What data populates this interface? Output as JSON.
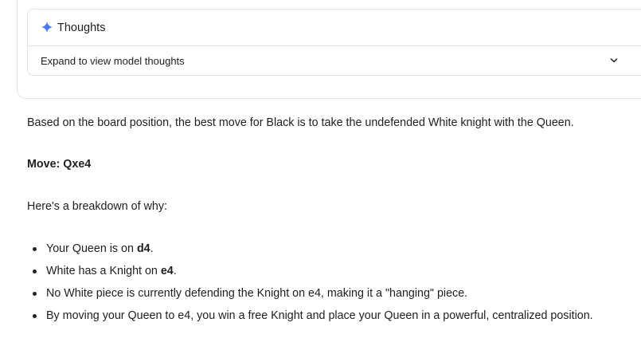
{
  "thoughts": {
    "title": "Thoughts",
    "expand_label": "Expand to view model thoughts",
    "icon": "sparkle-icon",
    "accent_color": "#4a7cf0"
  },
  "answer": {
    "intro": "Based on the board position, the best move for Black is to take the undefended White knight with the Queen.",
    "move": "Move: Qxe4",
    "breakdown_intro": "Here's a breakdown of why:",
    "bullets": [
      {
        "prefix": "Your Queen is on ",
        "bold": "d4",
        "suffix": "."
      },
      {
        "prefix": "White has a Knight on ",
        "bold": "e4",
        "suffix": "."
      },
      {
        "prefix": "No White piece is currently defending the Knight on e4, making it a \"hanging\" piece.",
        "bold": "",
        "suffix": ""
      },
      {
        "prefix": "By moving your Queen to e4, you win a free Knight and place your Queen in a powerful, centralized position.",
        "bold": "",
        "suffix": ""
      }
    ]
  }
}
